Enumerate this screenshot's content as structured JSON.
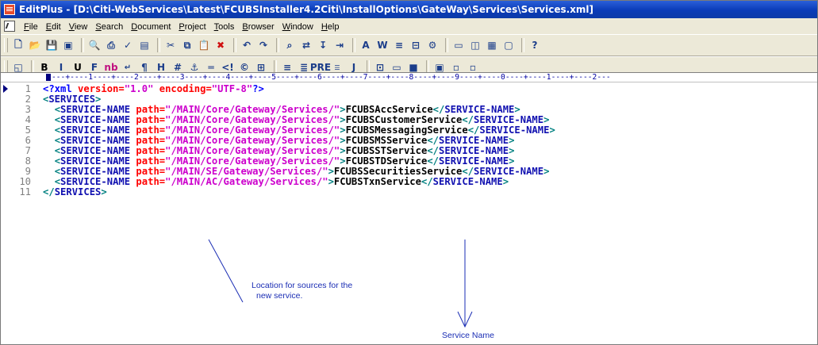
{
  "window": {
    "title": "EditPlus - [D:\\Citi-WebServices\\Latest\\FCUBSInstaller4.2Citi\\InstallOptions\\GateWay\\Services\\Services.xml]"
  },
  "menu": [
    {
      "mnemonic": "F",
      "rest": "ile"
    },
    {
      "mnemonic": "E",
      "rest": "dit"
    },
    {
      "mnemonic": "V",
      "rest": "iew"
    },
    {
      "mnemonic": "S",
      "rest": "earch"
    },
    {
      "mnemonic": "D",
      "rest": "ocument"
    },
    {
      "mnemonic": "P",
      "rest": "roject"
    },
    {
      "mnemonic": "T",
      "rest": "ools"
    },
    {
      "mnemonic": "B",
      "rest": "rowser"
    },
    {
      "mnemonic": "W",
      "rest": "indow"
    },
    {
      "mnemonic": "H",
      "rest": "elp"
    }
  ],
  "toolbar1": [
    "new-file-icon",
    "open-folder-icon",
    "save-icon",
    "save-all-icon",
    "|",
    "print-preview-icon",
    "print-icon",
    "spell-check-icon",
    "page-icon",
    "|",
    "cut-icon",
    "copy-icon",
    "paste-icon",
    "delete-icon",
    "|",
    "undo-icon",
    "redo-icon",
    "|",
    "find-icon",
    "replace-icon",
    "goto-icon",
    "indent-icon",
    "|",
    "font-icon",
    "word-wrap-icon",
    "line-number-icon",
    "column-icon",
    "settings-icon",
    "|",
    "window-icon",
    "split-icon",
    "fullscreen-icon",
    "monitor-icon",
    "|",
    "help-icon"
  ],
  "toolbar2": {
    "glyphs": [
      "B",
      "I",
      "U",
      "F",
      "nb",
      "↵",
      "¶",
      "H",
      "#",
      "⚓",
      "═",
      "<!",
      "©",
      "⊞",
      "≡",
      "≣",
      "PRE",
      "☰",
      "J",
      "⊡",
      "▭",
      "■",
      "▣"
    ],
    "icons": [
      "html-preview-icon",
      "bold-icon",
      "italic-icon",
      "underline-icon",
      "font-icon",
      "color-icon",
      "nbsp-icon",
      "break-icon",
      "paragraph-icon",
      "heading-icon",
      "image-icon",
      "anchor-icon",
      "hr-icon",
      "comment-icon",
      "copyright-icon",
      "table-icon",
      "align-icon",
      "list-icon",
      "pre-icon",
      "bullet-icon",
      "object-icon",
      "script-icon",
      "plugin-icon",
      "frame-icon",
      "layout-icon",
      "form-icon"
    ]
  },
  "ruler": "---+----1----+----2----+----3----+----4----+----5----+----6----+----7----+----8----+----9----+----0----+----1----+----2---",
  "code": {
    "line_numbers": [
      "1",
      "2",
      "3",
      "4",
      "5",
      "6",
      "7",
      "8",
      "9",
      "10",
      "11"
    ],
    "declaration": {
      "open": "<?xml ",
      "attr1": "version=",
      "val1": "\"1.0\"",
      "attr2": " encoding=",
      "val2": "\"UTF-8\"",
      "close": "?>"
    },
    "services_open": "SERVICES",
    "services_close": "SERVICES",
    "tag_name": "SERVICE-NAME",
    "attr_name": "path=",
    "entries": [
      {
        "path": "\"/MAIN/Core/Gateway/Services/\"",
        "service": "FCUBSAccService"
      },
      {
        "path": "\"/MAIN/Core/Gateway/Services/\"",
        "service": "FCUBSCustomerService"
      },
      {
        "path": "\"/MAIN/Core/Gateway/Services/\"",
        "service": "FCUBSMessagingService"
      },
      {
        "path": "\"/MAIN/Core/Gateway/Services/\"",
        "service": "FCUBSMSService"
      },
      {
        "path": "\"/MAIN/Core/Gateway/Services/\"",
        "service": "FCUBSSTService"
      },
      {
        "path": "\"/MAIN/Core/Gateway/Services/\"",
        "service": "FCUBSTDService"
      },
      {
        "path": "\"/MAIN/SE/Gateway/Services/\"",
        "service": "FCUBSSecuritiesService"
      },
      {
        "path": "\"/MAIN/AC/Gateway/Services/\"",
        "service": "FCUBSTxnService"
      }
    ]
  },
  "annotations": {
    "location_line1": "Location for sources for the",
    "location_line2": "new service.",
    "service_name": "Service Name"
  },
  "colors": {
    "title_bar": "#0a3bb8",
    "chrome": "#ece9d8",
    "tag": "#008080",
    "attr": "#ff0000",
    "value": "#cc00cc",
    "annotation": "#1a2db4"
  }
}
